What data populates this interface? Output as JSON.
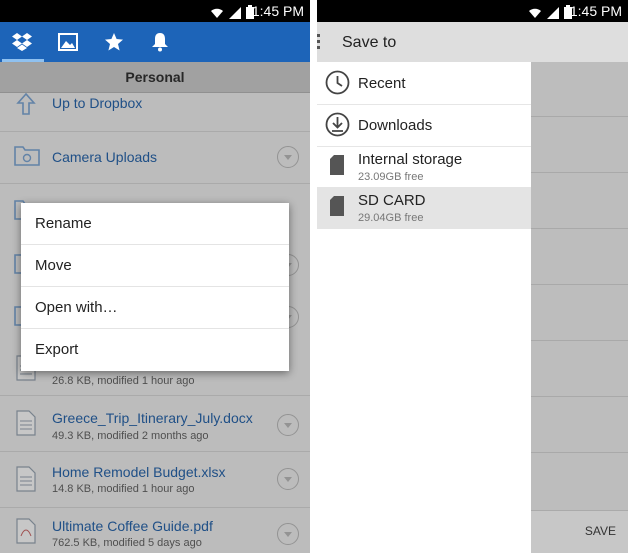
{
  "status": {
    "time": "1:45 PM"
  },
  "left": {
    "folder": "Personal",
    "items": [
      {
        "name": "Up to Dropbox",
        "meta": ""
      },
      {
        "name": "Camera Uploads",
        "meta": ""
      },
      {
        "name": "",
        "meta": "26.8 KB, modified 1 hour ago"
      },
      {
        "name": "Greece_Trip_Itinerary_July.docx",
        "meta": "49.3 KB, modified 2 months ago"
      },
      {
        "name": "Home Remodel Budget.xlsx",
        "meta": "14.8 KB, modified 1 hour ago"
      },
      {
        "name": "Ultimate Coffee Guide.pdf",
        "meta": "762.5 KB, modified 5 days ago"
      }
    ],
    "menu": [
      "Rename",
      "Move",
      "Open with…",
      "Export"
    ]
  },
  "right": {
    "title": "Save to",
    "drawer": [
      {
        "label": "Recent",
        "sub": ""
      },
      {
        "label": "Downloads",
        "sub": ""
      },
      {
        "label": "Internal storage",
        "sub": "23.09GB free"
      },
      {
        "label": "SD CARD",
        "sub": "29.04GB free"
      }
    ],
    "save_label": "SAVE"
  }
}
